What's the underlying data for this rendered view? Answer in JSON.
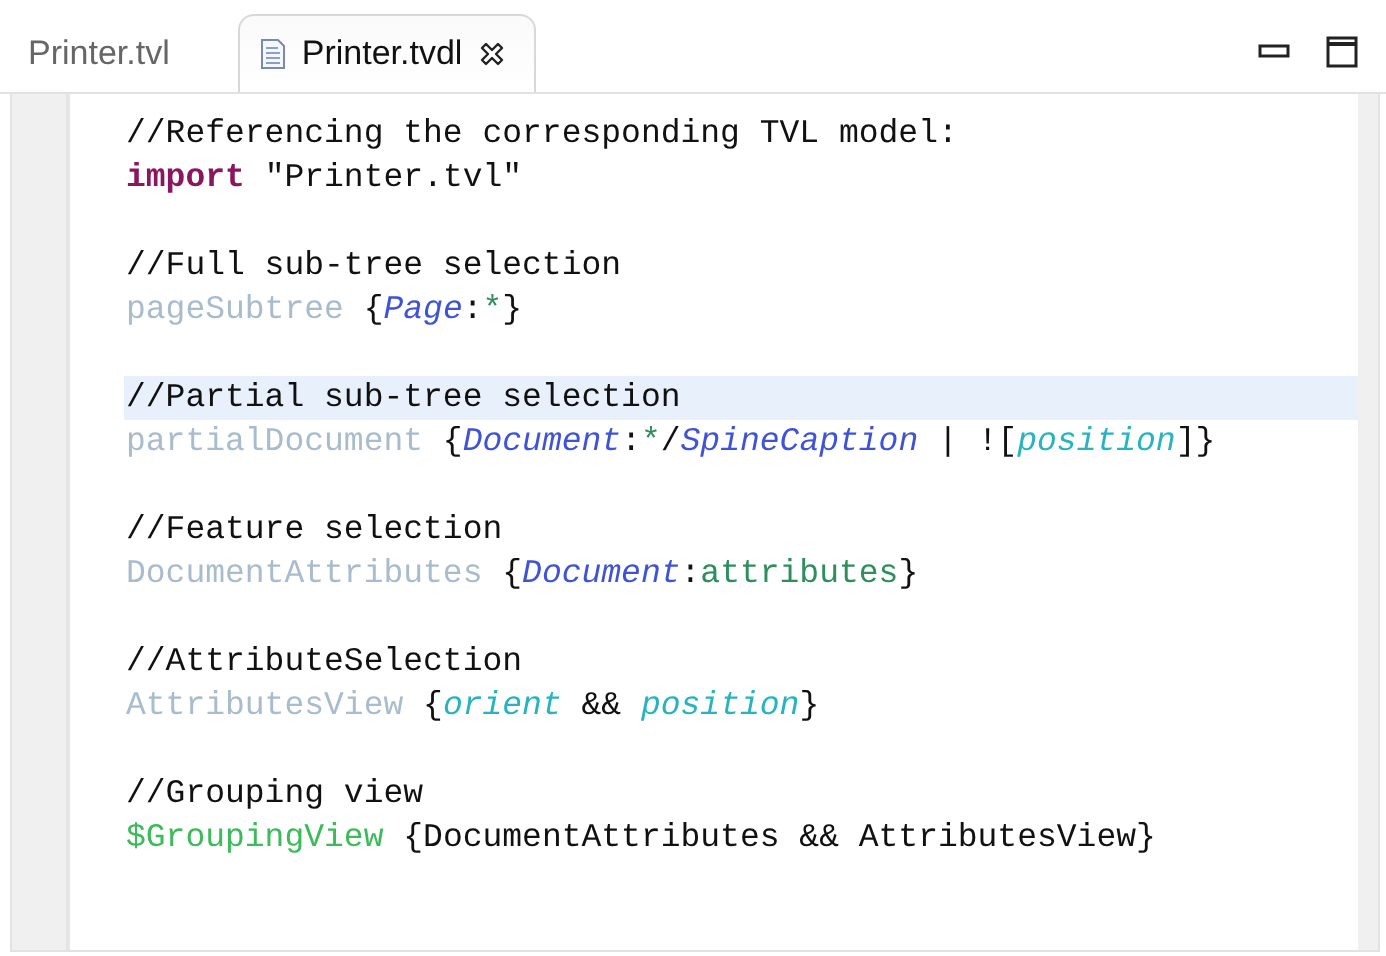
{
  "tabs": [
    {
      "label": "Printer.tvl",
      "selected": false
    },
    {
      "label": "Printer.tvdl",
      "selected": true,
      "closable": true
    }
  ],
  "editor": {
    "lines": [
      {
        "kind": "code",
        "current": false,
        "tokens": [
          {
            "kind": "comment",
            "text": "//Referencing the corresponding TVL model:"
          }
        ]
      },
      {
        "kind": "code",
        "current": false,
        "tokens": [
          {
            "kind": "keyword",
            "text": "import"
          },
          {
            "kind": "plain",
            "text": " \"Printer.tvl\""
          }
        ]
      },
      {
        "kind": "blank"
      },
      {
        "kind": "code",
        "current": false,
        "tokens": [
          {
            "kind": "comment",
            "text": "//Full sub-tree selection"
          }
        ]
      },
      {
        "kind": "code",
        "current": false,
        "tokens": [
          {
            "kind": "view",
            "text": "pageSubtree"
          },
          {
            "kind": "plain",
            "text": " {"
          },
          {
            "kind": "type",
            "text": "Page"
          },
          {
            "kind": "plain",
            "text": ":"
          },
          {
            "kind": "star",
            "text": "*"
          },
          {
            "kind": "plain",
            "text": "}"
          }
        ]
      },
      {
        "kind": "blank"
      },
      {
        "kind": "code",
        "current": true,
        "tokens": [
          {
            "kind": "comment",
            "text": "//Partial sub-tree selection"
          }
        ]
      },
      {
        "kind": "code",
        "current": false,
        "tokens": [
          {
            "kind": "view",
            "text": "partialDocument"
          },
          {
            "kind": "plain",
            "text": " {"
          },
          {
            "kind": "type",
            "text": "Document"
          },
          {
            "kind": "plain",
            "text": ":"
          },
          {
            "kind": "star",
            "text": "*"
          },
          {
            "kind": "plain",
            "text": "/"
          },
          {
            "kind": "type",
            "text": "SpineCaption"
          },
          {
            "kind": "plain",
            "text": " | !["
          },
          {
            "kind": "feature",
            "text": "position"
          },
          {
            "kind": "plain",
            "text": "]}"
          }
        ]
      },
      {
        "kind": "blank"
      },
      {
        "kind": "code",
        "current": false,
        "tokens": [
          {
            "kind": "comment",
            "text": "//Feature selection"
          }
        ]
      },
      {
        "kind": "code",
        "current": false,
        "tokens": [
          {
            "kind": "view",
            "text": "DocumentAttributes"
          },
          {
            "kind": "plain",
            "text": " {"
          },
          {
            "kind": "type",
            "text": "Document"
          },
          {
            "kind": "plain",
            "text": ":"
          },
          {
            "kind": "star",
            "text": "attributes"
          },
          {
            "kind": "plain",
            "text": "}"
          }
        ]
      },
      {
        "kind": "blank"
      },
      {
        "kind": "code",
        "current": false,
        "tokens": [
          {
            "kind": "comment",
            "text": "//AttributeSelection"
          }
        ]
      },
      {
        "kind": "code",
        "current": false,
        "tokens": [
          {
            "kind": "view",
            "text": "AttributesView"
          },
          {
            "kind": "plain",
            "text": " {"
          },
          {
            "kind": "feature",
            "text": "orient"
          },
          {
            "kind": "plain",
            "text": " && "
          },
          {
            "kind": "feature",
            "text": "position"
          },
          {
            "kind": "plain",
            "text": "}"
          }
        ]
      },
      {
        "kind": "blank"
      },
      {
        "kind": "code",
        "current": false,
        "tokens": [
          {
            "kind": "comment",
            "text": "//Grouping view"
          }
        ]
      },
      {
        "kind": "code",
        "current": false,
        "tokens": [
          {
            "kind": "group",
            "text": "$GroupingView"
          },
          {
            "kind": "plain",
            "text": " {DocumentAttributes && AttributesView}"
          }
        ]
      }
    ]
  }
}
